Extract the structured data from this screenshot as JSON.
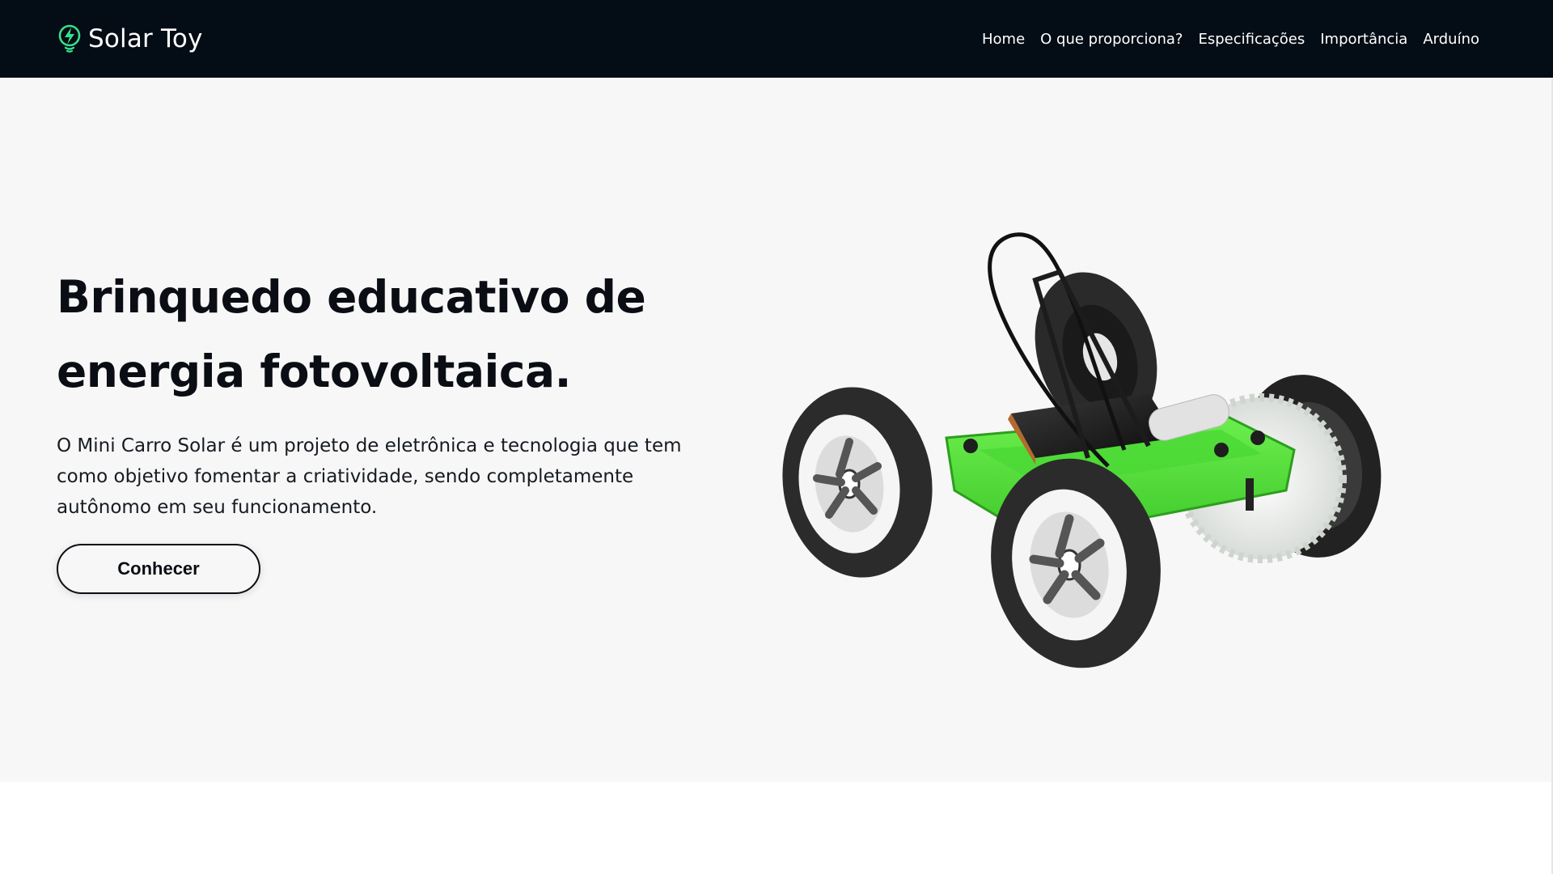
{
  "brand": {
    "name": "Solar Toy",
    "icon": "lightning-bolt-icon",
    "accent_color": "#37e08a"
  },
  "nav": {
    "background_color": "#040c15",
    "links": [
      {
        "label": "Home"
      },
      {
        "label": "O que proporciona?"
      },
      {
        "label": "Especificações"
      },
      {
        "label": "Importância"
      },
      {
        "label": "Arduíno"
      }
    ]
  },
  "hero": {
    "title_line1": "Brinquedo educativo de",
    "title_line2": "energia fotovoltaica.",
    "description": "O Mini Carro Solar é um projeto de eletrônica e tecnologia que tem como objetivo fomentar a criatividade, sendo completamente autônomo em seu funcionamento.",
    "button_label": "Conhecer",
    "background_color": "#f7f7f7",
    "image_subject": "solar-car-toy-image",
    "image_accent_color": "#52e83a"
  }
}
